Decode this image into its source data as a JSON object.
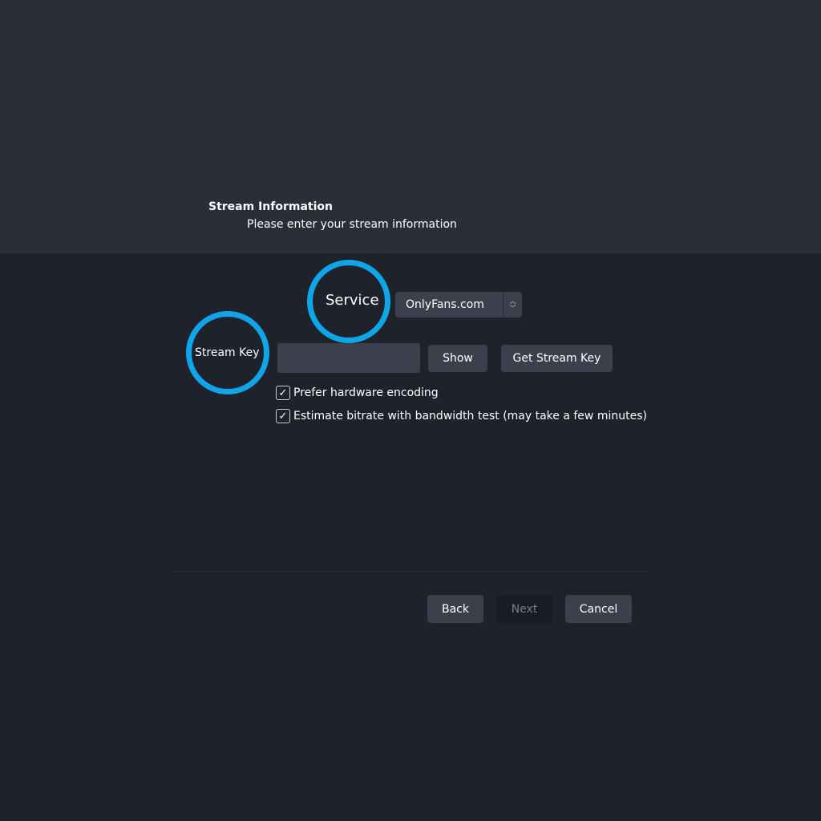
{
  "header": {
    "title": "Stream Information",
    "subtitle": "Please enter your stream information"
  },
  "form": {
    "service_label": "Service",
    "service_value": "OnlyFans.com",
    "stream_key_label": "Stream Key",
    "stream_key_value": "",
    "show_label": "Show",
    "get_stream_key_label": "Get Stream Key",
    "checkboxes": [
      {
        "label": "Prefer hardware encoding",
        "checked": true
      },
      {
        "label": "Estimate bitrate with bandwidth test (may take a few minutes)",
        "checked": true
      }
    ]
  },
  "footer": {
    "back_label": "Back",
    "next_label": "Next",
    "cancel_label": "Cancel"
  },
  "colors": {
    "highlight_ring": "#0ea5e9",
    "header_bg": "#2b2d37",
    "body_bg": "#1f222b",
    "control_bg": "#3c404d"
  }
}
